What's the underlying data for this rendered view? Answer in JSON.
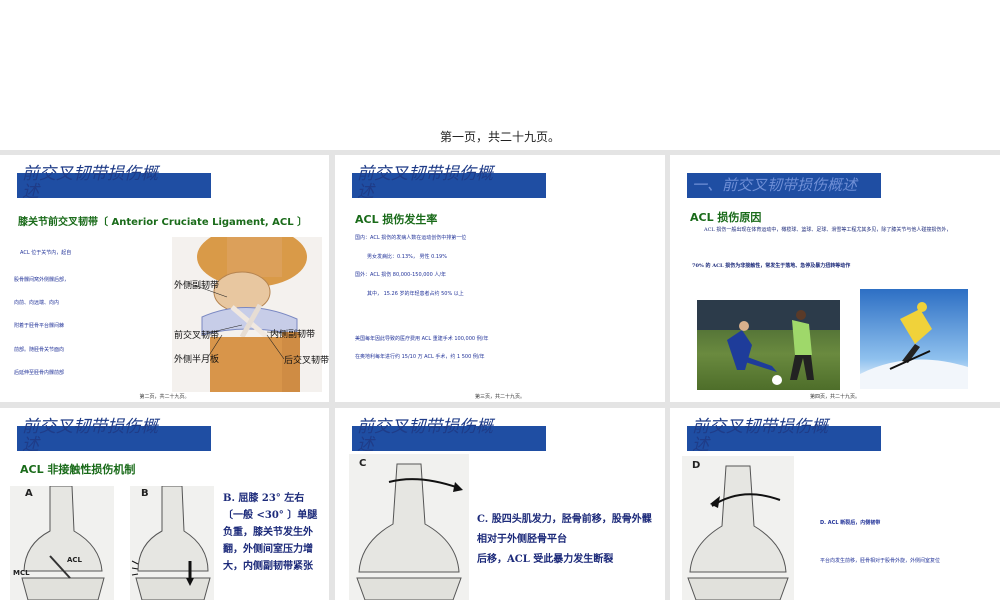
{
  "page_caption": "第一页，共二十九页。",
  "slides": [
    {
      "title": "前交叉韧带损伤概\n述",
      "subtitle": "膝关节前交叉韧带〔 Anterior  Cruciate Ligament, ACL 〕",
      "lines": [
        "ACL 位于关节内，起自",
        "股骨髁间窝外侧髁后部，",
        "向前、向远端、向内",
        "附着于胫骨平台髁间棘",
        "前部。随胫骨关节面向",
        "后延伸至胫骨内髁前部"
      ],
      "image_labels": [
        "外侧副韧带",
        "前交叉韧带",
        "外侧半月板",
        "内侧副韧带",
        "后交叉韧带"
      ],
      "footer": "第二页，共二十九页。"
    },
    {
      "title": "前交叉韧带损伤概\n述",
      "subtitle": "ACL 损伤发生率",
      "lines": [
        "国内：ACL 损伤的发病人数在运动创伤中排第一位",
        "男女发病比：0.13%，     男性 0.19%",
        "国外：ACL 损伤 80,000-150,000 人/年",
        "其中， 15.26 岁的年轻患者占约 50% 以上",
        "美国每年因此导致的医疗费用 ACL 重建手术 100,000 例/年",
        "在奥地利每年进行约 15/10 万 ACL 手术，约 1 500 例/年"
      ],
      "footer": "第三页，共二十九页。"
    },
    {
      "title": "一、前交叉韧带损伤概述",
      "subtitle": "ACL 损伤原因",
      "para1": "ACL 损伤一般出现在体育运动中，橄榄球、篮球、足球、滑雪等工程尤其多见，除了膝关节与他人碰撞损伤外，",
      "para2": "70% 的 ACL 损伤为非接触性，常发生于落地、急停及暴力扭转等动作",
      "footer": "第四页，共二十九页。"
    },
    {
      "title": "前交叉韧带损伤概\n述",
      "subtitle": "ACL 非接触性损伤机制",
      "letters": [
        "A",
        "B",
        "MCL",
        "ACL"
      ],
      "text": "B.  屈膝 23° 左右〔一般 <30° 〕单腿负重，膝关节发生外翻，外侧间室压力增大，内侧副韧带紧张"
    },
    {
      "title": "前交叉韧带损伤概\n述",
      "letter": "C",
      "text1": "C.  股四头肌发力，胫骨前移，股骨外髁相对于外侧胫骨平台",
      "text2": "后移，ACL 受此暴力发生断裂"
    },
    {
      "title": "前交叉韧带损伤概\n述",
      "letter": "D",
      "text1": "D.  ACL 断裂后，内侧韧带",
      "text2": "平台向发生前移，胫骨相对于股骨外旋，外侧间室复位"
    }
  ],
  "colors": {
    "title_bar": "#1f4ea3",
    "title_text": "#1f3c88",
    "subtitle": "#1a6b1a",
    "body_text": "#1c2a7a",
    "grid_bg": "#e4e4e4"
  }
}
